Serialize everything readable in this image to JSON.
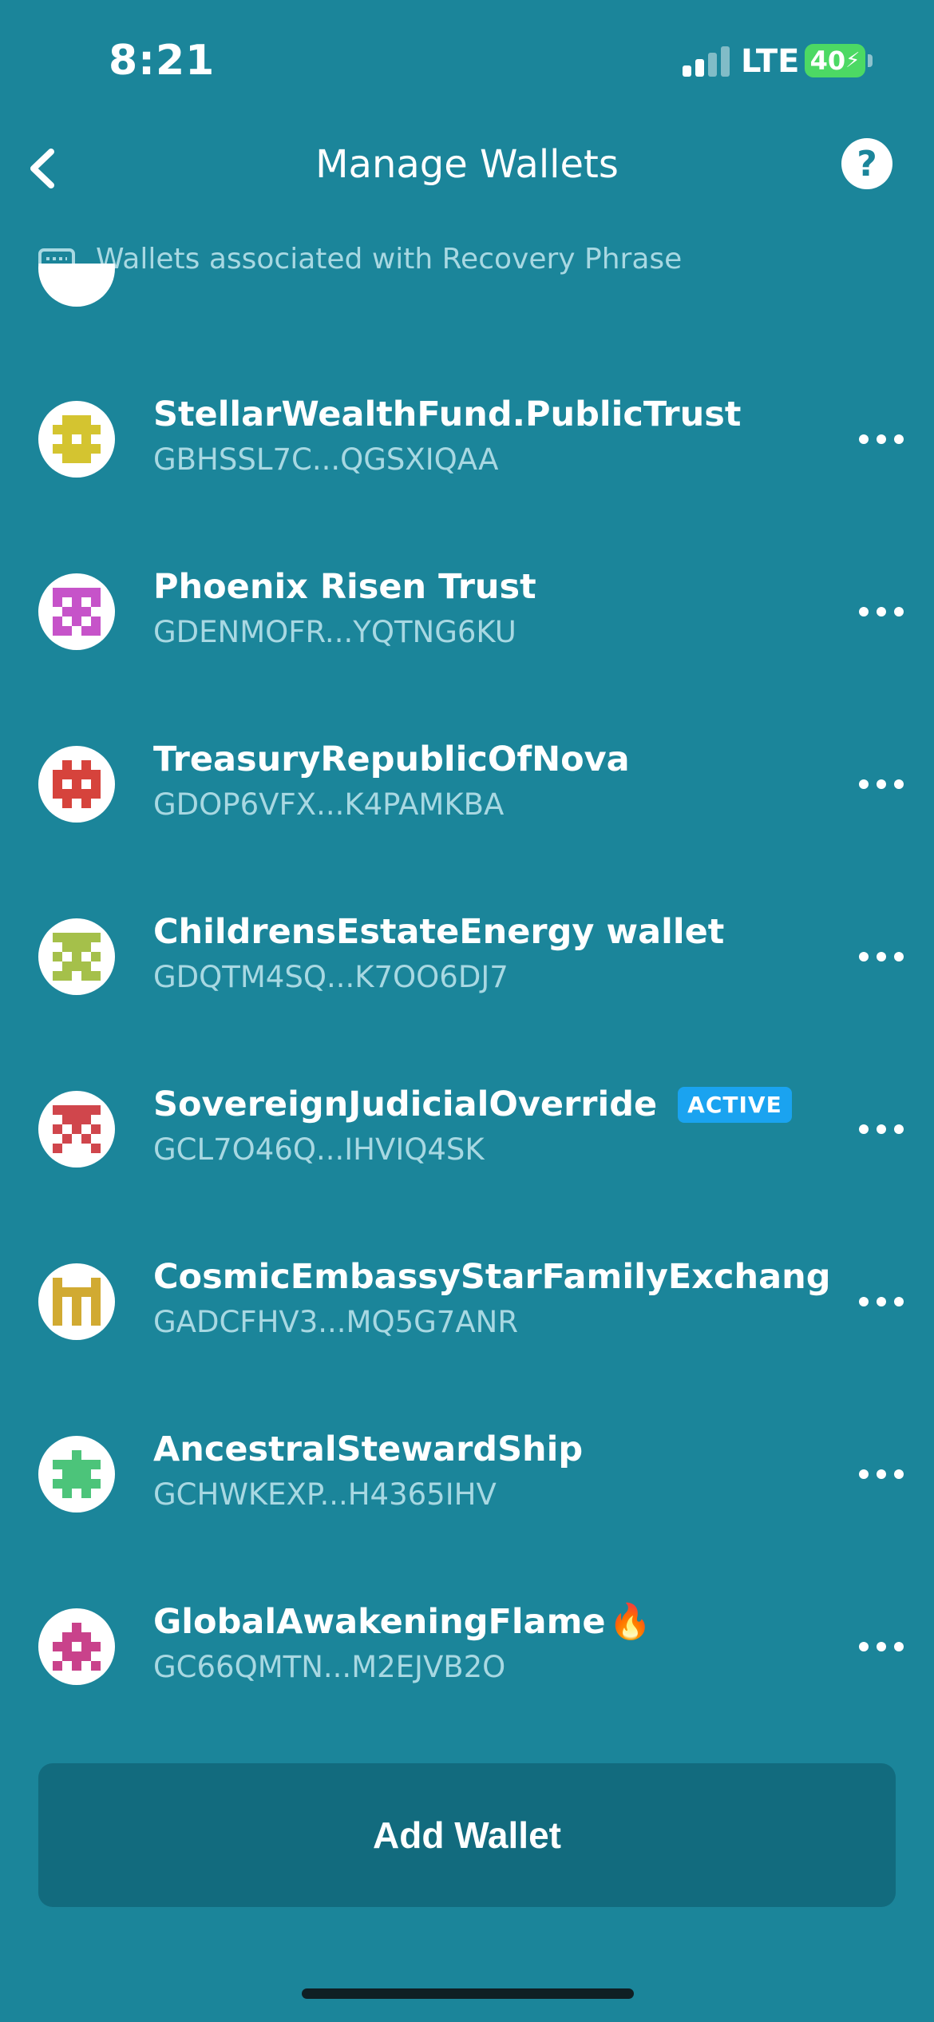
{
  "status_bar": {
    "time": "8:21",
    "network": "LTE",
    "battery": "40"
  },
  "header": {
    "title": "Manage Wallets",
    "help_icon": "?"
  },
  "section": {
    "label": "Wallets associated with Recovery Phrase"
  },
  "colors": {
    "background": "#1b859a",
    "button": "#126b7e",
    "active_badge": "#1aa3f0",
    "address": "#a8d8e2"
  },
  "wallets": [
    {
      "name": "StellarWealthFund.PublicTrust",
      "address": "GBHSSL7C...QGSXIQAA",
      "avatar_color": "#d4c430"
    },
    {
      "name": "Phoenix Risen Trust",
      "address": "GDENMOFR...YQTNG6KU",
      "avatar_color": "#c653c9"
    },
    {
      "name": "TreasuryRepublicOfNova",
      "address": "GDOP6VFX...K4PAMKBA",
      "avatar_color": "#d6433c"
    },
    {
      "name": "ChildrensEstateEnergy wallet",
      "address": "GDQTM4SQ...K7OO6DJ7",
      "avatar_color": "#a5c04a"
    },
    {
      "name": "SovereignJudicialOverride",
      "address": "GCL7O46Q...IHVIQ4SK",
      "avatar_color": "#d0464c",
      "badge": "ACTIVE"
    },
    {
      "name": "CosmicEmbassyStarFamilyExchang",
      "address": "GADCFHV3...MQ5G7ANR",
      "avatar_color": "#d1aa32"
    },
    {
      "name": "AncestralStewardShip",
      "address": "GCHWKEXP...H4365IHV",
      "avatar_color": "#4cc47a"
    },
    {
      "name": "GlobalAwakeningFlame",
      "address": "GC66QMTN...M2EJVB2O",
      "avatar_color": "#c9428b",
      "emoji": "🔥"
    }
  ],
  "add_button": {
    "label": "Add Wallet"
  }
}
